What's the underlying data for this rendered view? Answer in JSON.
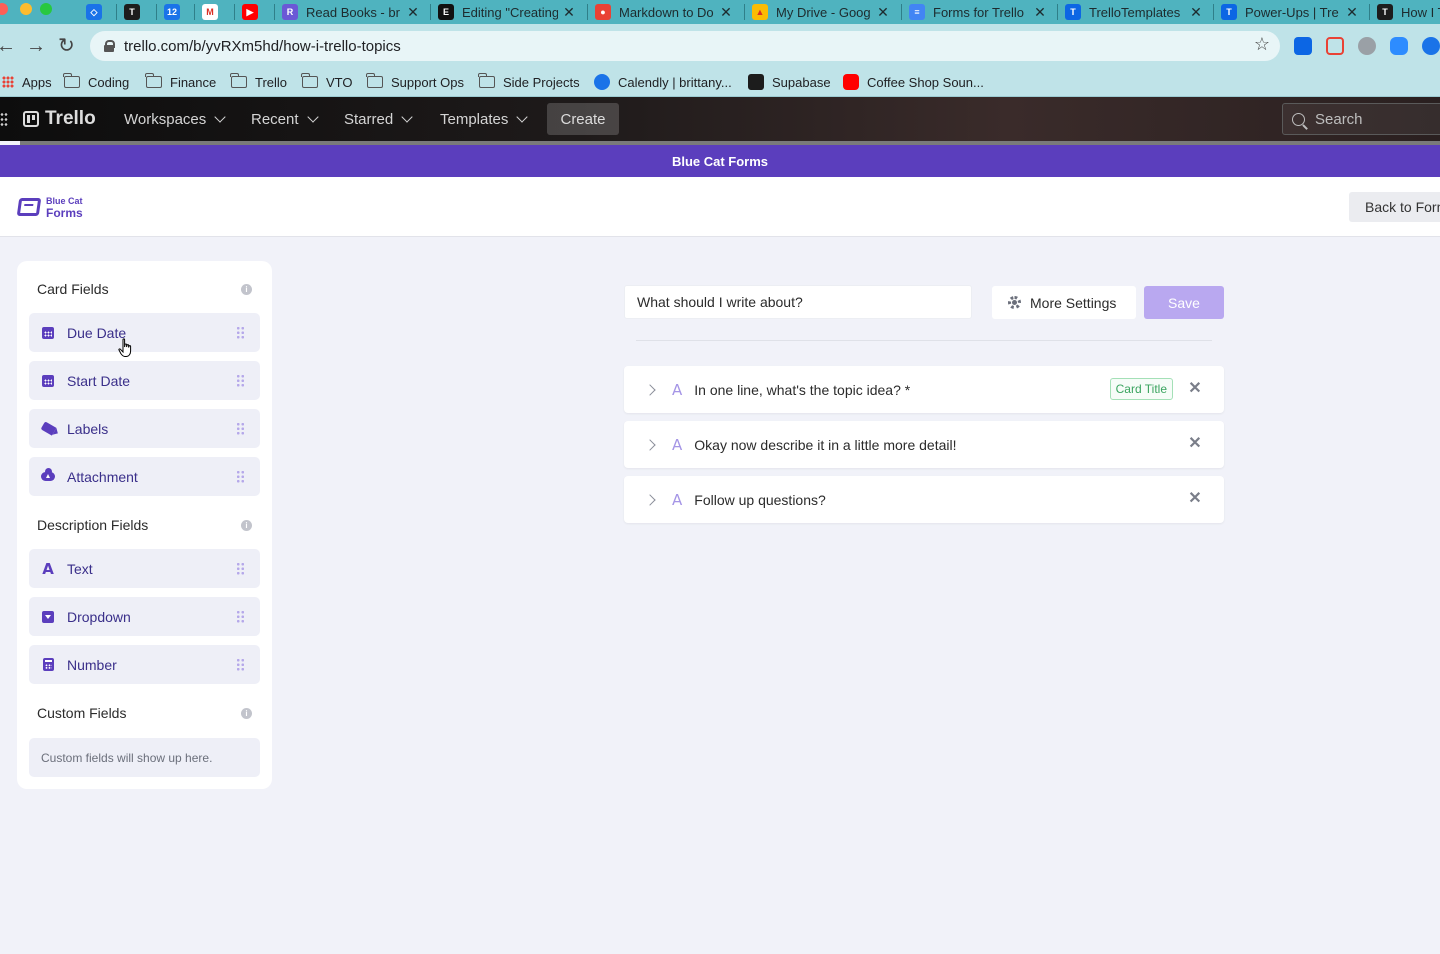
{
  "browser": {
    "tabs": [
      {
        "title": "",
        "color": "#1a73e8",
        "glyph": "◇"
      },
      {
        "title": "",
        "color": "#1d1d1d",
        "glyph": "T"
      },
      {
        "title": "",
        "color": "#1a73e8",
        "glyph": "12"
      },
      {
        "title": "",
        "color": "#ffffff",
        "glyph": "M"
      },
      {
        "title": "",
        "color": "#ff0000",
        "glyph": "▶"
      },
      {
        "title": "Read Books - br",
        "color": "#6b58d6",
        "glyph": "R"
      },
      {
        "title": "Editing \"Creating",
        "color": "#111111",
        "glyph": "E"
      },
      {
        "title": "Markdown to Do",
        "color": "#e94235",
        "glyph": "●"
      },
      {
        "title": "My Drive - Goog",
        "color": "#fbbc04",
        "glyph": "▲"
      },
      {
        "title": "Forms for Trello",
        "color": "#4285f4",
        "glyph": "≡"
      },
      {
        "title": "TrelloTemplates",
        "color": "#0c66e4",
        "glyph": "T"
      },
      {
        "title": "Power-Ups | Tre",
        "color": "#0c66e4",
        "glyph": "T"
      },
      {
        "title": "How I T",
        "color": "#1d1d1d",
        "glyph": "T"
      }
    ],
    "tab_close_glyph": "✕",
    "url": "trello.com/b/yvRXm5hd/how-i-trello-topics",
    "star_glyph": "☆",
    "back_glyph": "←",
    "forward_glyph": "→",
    "reload_glyph": "↻",
    "bookmarks": [
      {
        "label": "Apps",
        "icon": "apps-icon"
      },
      {
        "label": "Coding",
        "icon": "folder-icon"
      },
      {
        "label": "Finance",
        "icon": "folder-icon"
      },
      {
        "label": "Trello",
        "icon": "folder-icon"
      },
      {
        "label": "VTO",
        "icon": "folder-icon"
      },
      {
        "label": "Support Ops",
        "icon": "folder-icon"
      },
      {
        "label": "Side Projects",
        "icon": "folder-icon"
      },
      {
        "label": "Calendly | brittany...",
        "icon": "calendly-icon",
        "color": "#1a73e8"
      },
      {
        "label": "Supabase",
        "icon": "supabase-icon",
        "color": "#1c1c1c"
      },
      {
        "label": "Coffee Shop Soun...",
        "icon": "youtube-icon",
        "color": "#ff0000"
      }
    ]
  },
  "trello": {
    "logo": "Trello",
    "menu": [
      "Workspaces",
      "Recent",
      "Starred",
      "Templates"
    ],
    "create": "Create",
    "search_placeholder": "Search"
  },
  "powerup": {
    "title": "Blue Cat Forms",
    "logo_line1": "Blue Cat",
    "logo_line2": "Forms",
    "back_button": "Back to Forms"
  },
  "sidebar": {
    "sections": [
      {
        "title": "Card Fields",
        "fields": [
          {
            "label": "Due Date",
            "icon": "calendar-icon"
          },
          {
            "label": "Start Date",
            "icon": "calendar-icon"
          },
          {
            "label": "Labels",
            "icon": "tag-icon"
          },
          {
            "label": "Attachment",
            "icon": "cloud-upload-icon"
          }
        ]
      },
      {
        "title": "Description Fields",
        "fields": [
          {
            "label": "Text",
            "icon": "text-icon"
          },
          {
            "label": "Dropdown",
            "icon": "dropdown-icon"
          },
          {
            "label": "Number",
            "icon": "calculator-icon"
          }
        ]
      },
      {
        "title": "Custom Fields",
        "fields": []
      }
    ],
    "custom_empty": "Custom fields will show up here.",
    "info_glyph": "i"
  },
  "editor": {
    "form_title": "What should I write about?",
    "more_settings": "More Settings",
    "save": "Save",
    "type_glyph": "A",
    "close_glyph": "✕",
    "questions": [
      {
        "text": "In one line, what's the topic idea? *",
        "badge": "Card Title"
      },
      {
        "text": "Okay now describe it in a little more detail!",
        "badge": ""
      },
      {
        "text": "Follow up questions?",
        "badge": ""
      }
    ]
  },
  "colors": {
    "accent": "#5b3ebd",
    "save_disabled": "#b9a8f0",
    "badge_green": "#3aa45f"
  }
}
